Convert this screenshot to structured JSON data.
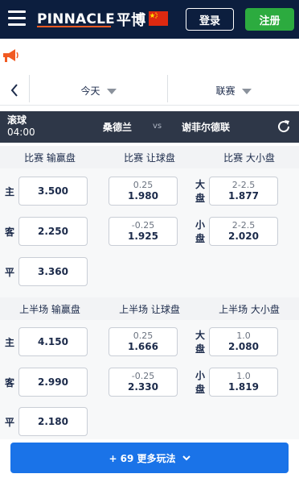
{
  "header": {
    "logo_text": "PINNACLE",
    "logo_cn": "平博",
    "login_label": "登录",
    "register_label": "注册"
  },
  "filters": {
    "date_label": "今天",
    "league_label": "联赛"
  },
  "match": {
    "status": "滚球",
    "clock": "04:00",
    "home": "桑德兰",
    "vs": "vs",
    "away": "谢菲尔德联"
  },
  "full_time": {
    "headers": [
      "比赛 输赢盘",
      "比赛 让球盘",
      "比赛 大小盘"
    ],
    "moneyline": {
      "home_label": "主",
      "home": "3.500",
      "away_label": "客",
      "away": "2.250",
      "draw_label": "平",
      "draw": "3.360"
    },
    "handicap": [
      {
        "line": "0.25",
        "price": "1.980"
      },
      {
        "line": "-0.25",
        "price": "1.925"
      }
    ],
    "totals": [
      {
        "label": "大盘",
        "line": "2-2.5",
        "price": "1.877"
      },
      {
        "label": "小盘",
        "line": "2-2.5",
        "price": "2.020"
      }
    ]
  },
  "first_half": {
    "headers": [
      "上半场 输赢盘",
      "上半场 让球盘",
      "上半场 大小盘"
    ],
    "moneyline": {
      "home_label": "主",
      "home": "4.150",
      "away_label": "客",
      "away": "2.990",
      "draw_label": "平",
      "draw": "2.180"
    },
    "handicap": [
      {
        "line": "0.25",
        "price": "1.666"
      },
      {
        "line": "-0.25",
        "price": "2.330"
      }
    ],
    "totals": [
      {
        "label": "大盘",
        "line": "1.0",
        "price": "2.080"
      },
      {
        "label": "小盘",
        "line": "1.0",
        "price": "1.819"
      }
    ]
  },
  "more_button": "+ 69 更多玩法",
  "colors": {
    "header_bg": "#0c1e3e",
    "register": "#2cab3f",
    "accent": "#1a73e8",
    "match_bar": "#2e3748",
    "announce": "#f15a22"
  }
}
